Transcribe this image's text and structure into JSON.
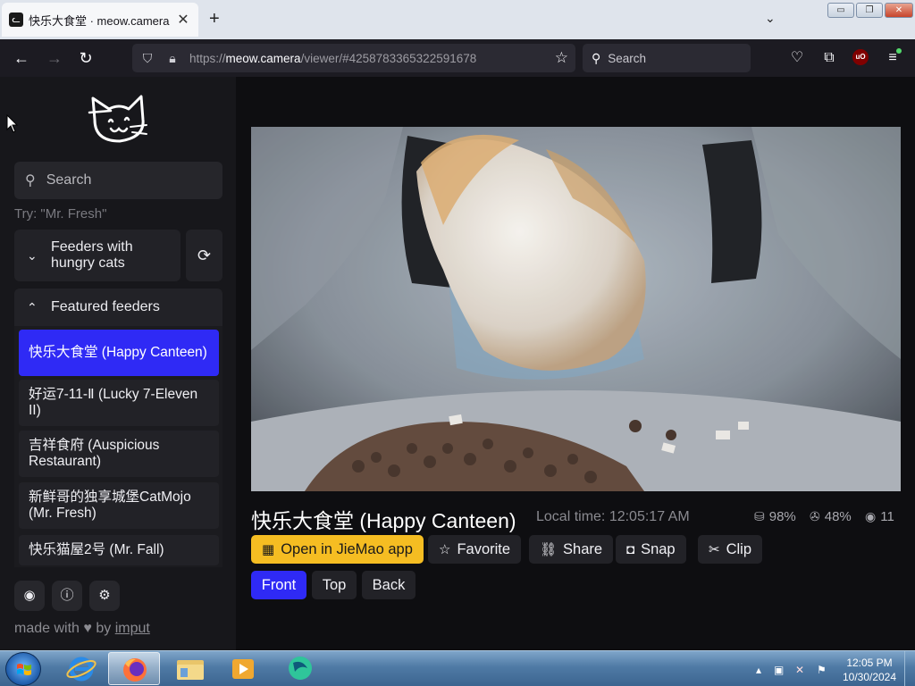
{
  "browser": {
    "tab_title": "快乐大食堂 · meow.camera",
    "url_prefix": "https://",
    "url_host": "meow.camera",
    "url_path": "/viewer/#4258783365322591678",
    "search_placeholder": "Search"
  },
  "sidebar": {
    "search_placeholder": "Search",
    "search_hint": "Try: \"Mr. Fresh\"",
    "group_hungry": "Feeders with hungry cats",
    "group_featured": "Featured feeders",
    "feeders": [
      {
        "label": "快乐大食堂 (Happy Canteen)",
        "active": true
      },
      {
        "label": "好运7-11-Ⅱ (Lucky 7-Eleven II)",
        "active": false
      },
      {
        "label": "吉祥食府 (Auspicious Restaurant)",
        "active": false
      },
      {
        "label": "新鲜哥的独享城堡CatMojo (Mr. Fresh)",
        "active": false
      },
      {
        "label": "快乐猫屋2号 (Mr. Fall)",
        "active": false
      }
    ],
    "footer_made_with": "made with",
    "footer_by": "by",
    "footer_link": "imput"
  },
  "viewer": {
    "title": "快乐大食堂 (Happy Canteen)",
    "local_time": "Local time: 12:05:17 AM",
    "stats": {
      "food_level": "98%",
      "battery": "48%",
      "viewers": "11"
    },
    "actions": {
      "open_app": "Open in JieMao app",
      "favorite": "Favorite",
      "share": "Share",
      "snap": "Snap",
      "clip": "Clip"
    },
    "camera_views": [
      "Front",
      "Top",
      "Back"
    ],
    "active_view": "Front"
  },
  "taskbar": {
    "time": "12:05 PM",
    "date": "10/30/2024"
  },
  "colors": {
    "accent_blue": "#2f2af5",
    "accent_yellow": "#f5bd22",
    "sidebar_bg": "#17171b"
  }
}
